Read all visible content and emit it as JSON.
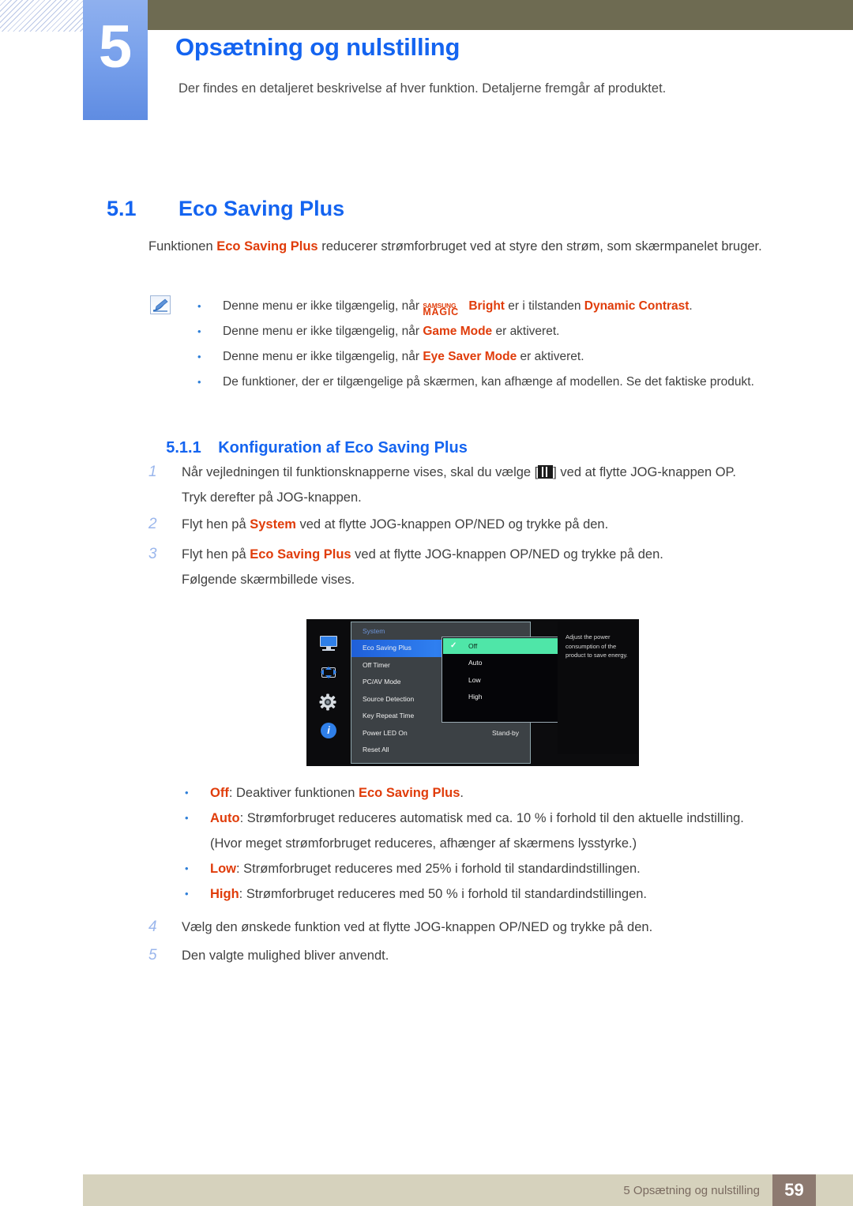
{
  "chapter": {
    "number": "5",
    "title": "Opsætning og nulstilling",
    "subtitle": "Der findes en detaljeret beskrivelse af hver funktion. Detaljerne fremgår af produktet."
  },
  "section": {
    "number": "5.1",
    "title": "Eco Saving Plus",
    "intro_a": "Funktionen ",
    "intro_hl": "Eco Saving Plus",
    "intro_b": " reducerer strømforbruget ved at styre den strøm, som skærmpanelet bruger."
  },
  "notes": {
    "icon_name": "note-pen-icon",
    "items": [
      {
        "a": "Denne menu er ikke tilgængelig, når ",
        "magic_top": "SAMSUNG",
        "magic_bottom": "MAGIC",
        "magic_suffix": "Bright",
        "b": " er i tilstanden ",
        "hl": "Dynamic Contrast",
        "c": "."
      },
      {
        "a": "Denne menu er ikke tilgængelig, når ",
        "hl": "Game Mode",
        "c": " er aktiveret."
      },
      {
        "a": "Denne menu er ikke tilgængelig, når ",
        "hl": "Eye Saver Mode",
        "c": " er aktiveret."
      },
      {
        "a": "De funktioner, der er tilgængelige på skærmen, kan afhænge af modellen. Se det faktiske produkt.",
        "hl": "",
        "c": ""
      }
    ]
  },
  "subsection": {
    "number": "5.1.1",
    "title": "Konfiguration af Eco Saving Plus"
  },
  "steps": {
    "step1": {
      "n": "1",
      "a": "Når vejledningen til funktionsknapperne vises, skal du vælge [",
      "icon": "menu-bars-icon",
      "b": "] ved at flytte JOG-knappen OP.",
      "line2": "Tryk derefter på JOG-knappen."
    },
    "step2": {
      "n": "2",
      "a": "Flyt hen på ",
      "hl": "System",
      "b": " ved at flytte JOG-knappen OP/NED og trykke på den."
    },
    "step3": {
      "n": "3",
      "a": "Flyt hen på ",
      "hl": "Eco Saving Plus",
      "b": " ved at flytte JOG-knappen OP/NED og trykke på den.",
      "line2": "Følgende skærmbillede vises."
    },
    "step4": {
      "n": "4",
      "a": "Vælg den ønskede funktion ved at flytte JOG-knappen OP/NED og trykke på den."
    },
    "step5": {
      "n": "5",
      "a": "Den valgte mulighed bliver anvendt."
    }
  },
  "osd": {
    "side_icons": [
      "monitor-icon",
      "dpad-icon",
      "gear-icon",
      "info-icon"
    ],
    "title": "System",
    "rows": [
      {
        "label": "Eco Saving Plus",
        "value": "",
        "selected": true
      },
      {
        "label": "Off Timer",
        "value": "",
        "selected": false
      },
      {
        "label": "PC/AV Mode",
        "value": "",
        "selected": false
      },
      {
        "label": "Source Detection",
        "value": "",
        "selected": false
      },
      {
        "label": "Key Repeat Time",
        "value": "",
        "selected": false
      },
      {
        "label": "Power LED On",
        "value": "Stand-by",
        "selected": false
      },
      {
        "label": "Reset All",
        "value": "",
        "selected": false
      }
    ],
    "popup_options": [
      {
        "label": "Off",
        "checked": true
      },
      {
        "label": "Auto",
        "checked": false
      },
      {
        "label": "Low",
        "checked": false
      },
      {
        "label": "High",
        "checked": false
      }
    ],
    "description": "Adjust the power consumption of the product to save energy.",
    "colors": {
      "selected_blue": "#2f7ff0",
      "option_green": "#4fe6a8",
      "panel_gray": "#3c4145",
      "background_black": "#0c0c0e"
    }
  },
  "options": {
    "off": {
      "name": "Off",
      "sep": ": Deaktiver funktionen ",
      "hl2": "Eco Saving Plus",
      "tail": "."
    },
    "auto": {
      "name": "Auto",
      "sep": ": Strømforbruget reduceres automatisk med ca. 10 % i forhold til den aktuelle indstilling.",
      "sub": "(Hvor meget strømforbruget reduceres, afhænger af skærmens lysstyrke.)"
    },
    "low": {
      "name": "Low",
      "sep": ": Strømforbruget reduceres med 25% i forhold til standardindstillingen."
    },
    "high": {
      "name": "High",
      "sep": ": Strømforbruget reduceres med 50 % i forhold til standardindstillingen."
    }
  },
  "footer": {
    "text": "5 Opsætning og nulstilling",
    "page": "59"
  },
  "theme": {
    "accent_blue": "#1464f0",
    "highlight_red": "#e03c0a",
    "olive": "#6e6b52",
    "footer_beige": "#d6d2bd",
    "footer_brown": "#8d7a70"
  }
}
